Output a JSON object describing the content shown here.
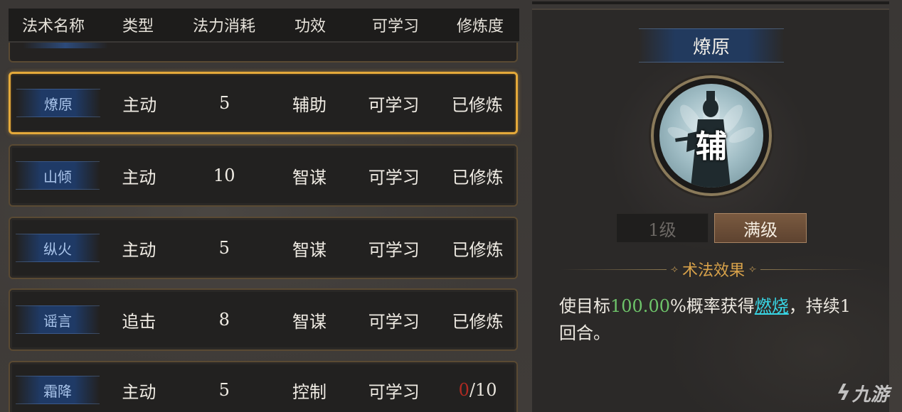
{
  "table": {
    "headers": [
      "法术名称",
      "类型",
      "法力消耗",
      "功效",
      "可学习",
      "修炼度"
    ],
    "rows": [
      {
        "name": "燎原",
        "type": "主动",
        "cost": "5",
        "effect": "辅助",
        "learn": "可学习",
        "progress": "已修炼",
        "selected": true
      },
      {
        "name": "山倾",
        "type": "主动",
        "cost": "10",
        "effect": "智谋",
        "learn": "可学习",
        "progress": "已修炼",
        "selected": false
      },
      {
        "name": "纵火",
        "type": "主动",
        "cost": "5",
        "effect": "智谋",
        "learn": "可学习",
        "progress": "已修炼",
        "selected": false
      },
      {
        "name": "谣言",
        "type": "追击",
        "cost": "8",
        "effect": "智谋",
        "learn": "可学习",
        "progress": "已修炼",
        "selected": false
      },
      {
        "name": "霜降",
        "type": "主动",
        "cost": "5",
        "effect": "控制",
        "learn": "可学习",
        "progress_current": "0",
        "progress_max": "/10",
        "selected": false
      }
    ]
  },
  "detail": {
    "title": "燎原",
    "portrait_glyph": "辅",
    "level_1": "1级",
    "level_max": "满级",
    "effect_header": "术法效果",
    "effect_pre": "使目标",
    "effect_pct": "100.00",
    "effect_mid": "%概率获得",
    "effect_keyword": "燃烧",
    "effect_post": "，持续1回合。"
  },
  "watermark": {
    "mark": "ϟ",
    "text": "九游"
  },
  "colors": {
    "selected_border": "#e4a93a",
    "percent_green": "#6ec46a",
    "keyword_cyan": "#38d7e6",
    "effect_header_gold": "#d8a24a",
    "progress_red": "#b02a22"
  }
}
